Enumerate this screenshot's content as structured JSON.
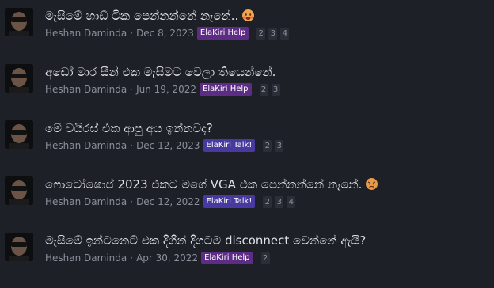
{
  "colors": {
    "background": "#1e2027",
    "elakiri_help": "#5d2d86",
    "elakiri_talk": "#463aa0"
  },
  "threads": [
    {
      "title": "මැසිමේ හාඩ් ටික පෙන්නන්නේ නෑනේ..",
      "emoji": "hot-face-emoji",
      "author": "Heshan Daminda",
      "date": "Dec 8, 2023",
      "tag": "ElaKiri Help",
      "tag_color": "#5d2d86",
      "pages": [
        "2",
        "3",
        "4"
      ]
    },
    {
      "title": "අඩෝ මාර සීන් එක මැසිමට වෙලා තියෙන්නේ.",
      "emoji": "",
      "author": "Heshan Daminda",
      "date": "Jun 19, 2022",
      "tag": "ElaKiri Help",
      "tag_color": "#5d2d86",
      "pages": [
        "2",
        "3"
      ]
    },
    {
      "title": "මේ වයිරස් එක ආපු අය ඉන්නවද?",
      "emoji": "",
      "author": "Heshan Daminda",
      "date": "Dec 12, 2023",
      "tag": "ElaKiri Talk!",
      "tag_color": "#463aa0",
      "pages": [
        "2",
        "3"
      ]
    },
    {
      "title": "ෆොටෝෂොප් 2023 එකට මගේ VGA එක පෙන්නන්නේ නෑනේ.",
      "emoji": "angry-face-emoji",
      "author": "Heshan Daminda",
      "date": "Dec 12, 2022",
      "tag": "ElaKiri Talk!",
      "tag_color": "#463aa0",
      "pages": [
        "2",
        "3",
        "4"
      ]
    },
    {
      "title": "මැසිමේ ඉන්ටනෙට් එක දිගින් දිගටම disconnect වෙන්නේ ඇයි?",
      "emoji": "",
      "author": "Heshan Daminda",
      "date": "Apr 30, 2022",
      "tag": "ElaKiri Help",
      "tag_color": "#5d2d86",
      "pages": [
        "2"
      ]
    }
  ]
}
